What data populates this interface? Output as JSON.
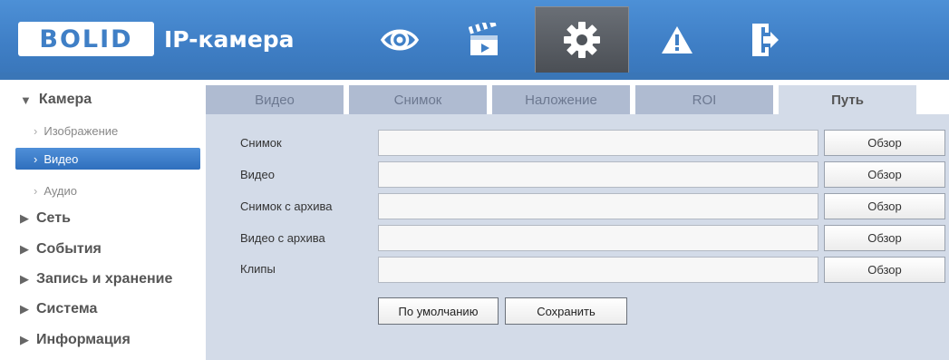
{
  "header": {
    "logo": "BOLID",
    "app_title": "IP-камера",
    "nav": [
      {
        "icon": "eye-icon",
        "active": false
      },
      {
        "icon": "clapperboard-icon",
        "active": false
      },
      {
        "icon": "gear-icon",
        "active": true
      },
      {
        "icon": "warning-icon",
        "active": false
      },
      {
        "icon": "logout-icon",
        "active": false
      }
    ]
  },
  "sidebar": {
    "camera": {
      "label": "Камера",
      "expanded": true,
      "items": [
        {
          "label": "Изображение",
          "active": false
        },
        {
          "label": "Видео",
          "active": true
        },
        {
          "label": "Аудио",
          "active": false
        }
      ]
    },
    "categories": [
      {
        "label": "Сеть"
      },
      {
        "label": "События"
      },
      {
        "label": "Запись и хранение"
      },
      {
        "label": "Система"
      },
      {
        "label": "Информация"
      }
    ]
  },
  "tabs": [
    {
      "label": "Видео",
      "active": false
    },
    {
      "label": "Снимок",
      "active": false
    },
    {
      "label": "Наложение",
      "active": false
    },
    {
      "label": "ROI",
      "active": false
    },
    {
      "label": "Путь",
      "active": true
    }
  ],
  "paths": {
    "browse_label": "Обзор",
    "rows": [
      {
        "label": "Снимок",
        "value": ""
      },
      {
        "label": "Видео",
        "value": ""
      },
      {
        "label": "Снимок с архива",
        "value": ""
      },
      {
        "label": "Видео с архива",
        "value": ""
      },
      {
        "label": "Клипы",
        "value": ""
      }
    ]
  },
  "actions": {
    "default_label": "По умолчанию",
    "save_label": "Сохранить"
  },
  "colors": {
    "header": "#3f7fc6",
    "active_nav": "#555a60",
    "tab_inactive": "#afbbd1",
    "panel": "#d3dbe8",
    "sidebar_active": "#3a7ac7"
  }
}
